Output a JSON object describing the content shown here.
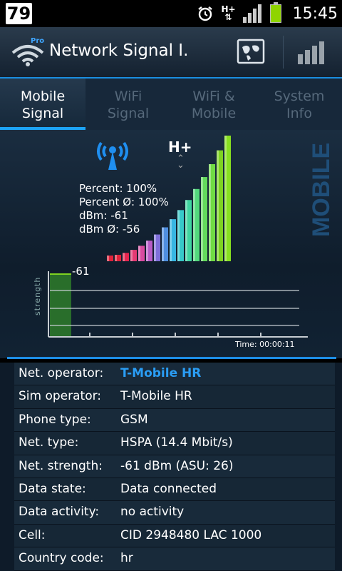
{
  "statusbar": {
    "badge": "79",
    "network": "H+",
    "time": "15:45"
  },
  "header": {
    "title": "Network Signal I.",
    "logo_badge": "Pro"
  },
  "tabs": [
    {
      "label": "Mobile\nSignal",
      "active": true
    },
    {
      "label": "WiFi\nSignal",
      "active": false
    },
    {
      "label": "WiFi &\nMobile",
      "active": false
    },
    {
      "label": "System\nInfo",
      "active": false
    }
  ],
  "panel": {
    "side_label": "MOBILE",
    "network_type": "H+",
    "stats": {
      "percent": "Percent: 100%",
      "percent_avg": "Percent Ø: 100%",
      "dbm": "dBm: -61",
      "dbm_avg": "dBm Ø: -56"
    },
    "signal_level_percent": 100,
    "graph": {
      "current_value": "-61",
      "y_label": "strength",
      "time_label": "Time: 00:00:11"
    }
  },
  "info_rows": [
    {
      "key": "Net. operator:",
      "value": "T-Mobile HR",
      "accent": true
    },
    {
      "key": "Sim operator:",
      "value": "T-Mobile HR"
    },
    {
      "key": "Phone type:",
      "value": "GSM"
    },
    {
      "key": "Net. type:",
      "value": "HSPA (14.4 Mbit/s)"
    },
    {
      "key": "Net. strength:",
      "value": "-61 dBm (ASU: 26)"
    },
    {
      "key": "Data state:",
      "value": "Data connected"
    },
    {
      "key": "Data activity:",
      "value": "no activity"
    },
    {
      "key": "Cell:",
      "value": "CID 2948480 LAC 1000"
    },
    {
      "key": "Country code:",
      "value": "hr"
    }
  ],
  "colors": {
    "accent": "#1da4f5",
    "bar_green": "#7ed321",
    "bar_red": "#e0213a"
  }
}
